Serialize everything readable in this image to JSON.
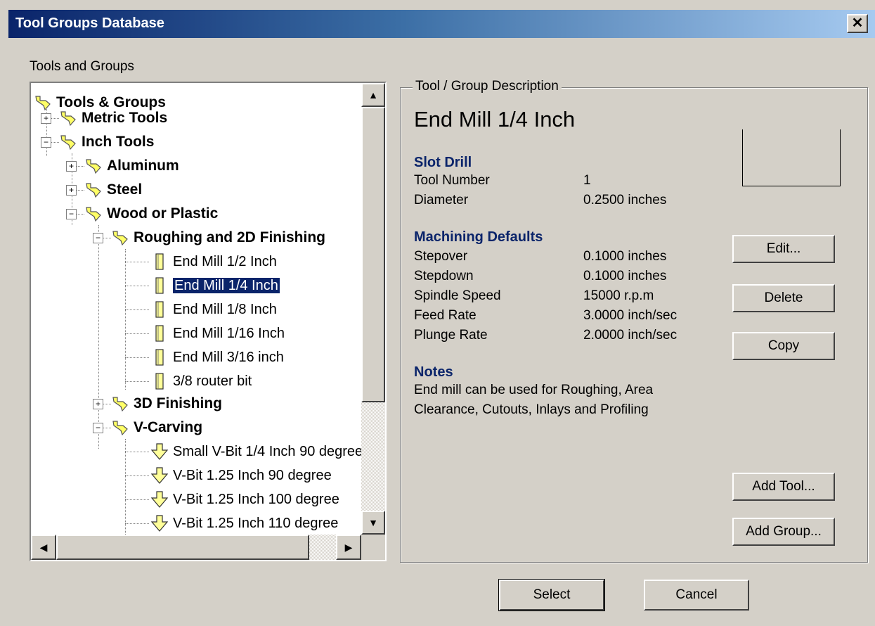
{
  "window": {
    "title": "Tool Groups Database",
    "close_label": "✕"
  },
  "tree_label": "Tools and Groups",
  "tree": {
    "nodes": [
      {
        "label": "Tools & Groups"
      },
      {
        "label": "Metric Tools"
      },
      {
        "label": "Inch Tools"
      },
      {
        "label": "Aluminum"
      },
      {
        "label": "Steel"
      },
      {
        "label": "Wood or Plastic"
      },
      {
        "label": "Roughing and 2D Finishing"
      },
      {
        "label": "End Mill 1/2 Inch"
      },
      {
        "label": "End Mill 1/4 Inch"
      },
      {
        "label": "End Mill 1/8 Inch"
      },
      {
        "label": "End Mill 1/16 Inch"
      },
      {
        "label": "End Mill 3/16 inch"
      },
      {
        "label": "3/8 router bit"
      },
      {
        "label": "3D Finishing"
      },
      {
        "label": "V-Carving"
      },
      {
        "label": "Small V-Bit 1/4 Inch 90 degree"
      },
      {
        "label": "V-Bit 1.25 Inch 90 degree"
      },
      {
        "label": "V-Bit 1.25 Inch 100 degree"
      },
      {
        "label": "V-Bit 1.25 Inch 110 degree"
      }
    ]
  },
  "description": {
    "legend": "Tool / Group Description",
    "title": "End Mill 1/4 Inch",
    "tool_type": "Slot Drill",
    "tool_number_label": "Tool Number",
    "tool_number": "1",
    "diameter_label": "Diameter",
    "diameter": "0.2500 inches",
    "machining_heading": "Machining Defaults",
    "stepover_label": "Stepover",
    "stepover": "0.1000 inches",
    "stepdown_label": "Stepdown",
    "stepdown": "0.1000 inches",
    "spindle_label": "Spindle Speed",
    "spindle": "15000 r.p.m",
    "feed_label": "Feed Rate",
    "feed": "3.0000 inch/sec",
    "plunge_label": "Plunge Rate",
    "plunge": "2.0000 inch/sec",
    "notes_heading": "Notes",
    "notes_line1": "End mill can be used for Roughing, Area",
    "notes_line2": "Clearance, Cutouts, Inlays and Profiling"
  },
  "buttons": {
    "edit": "Edit...",
    "delete": "Delete",
    "copy": "Copy",
    "add_tool": "Add Tool...",
    "add_group": "Add Group...",
    "select": "Select",
    "cancel": "Cancel"
  },
  "icons": {
    "group": "tool-group-icon",
    "endmill": "end-mill-icon",
    "vbit": "v-bit-icon"
  },
  "colors": {
    "selection": "#0a246a",
    "heading": "#0a246a",
    "window_bg": "#d4d0c8"
  }
}
